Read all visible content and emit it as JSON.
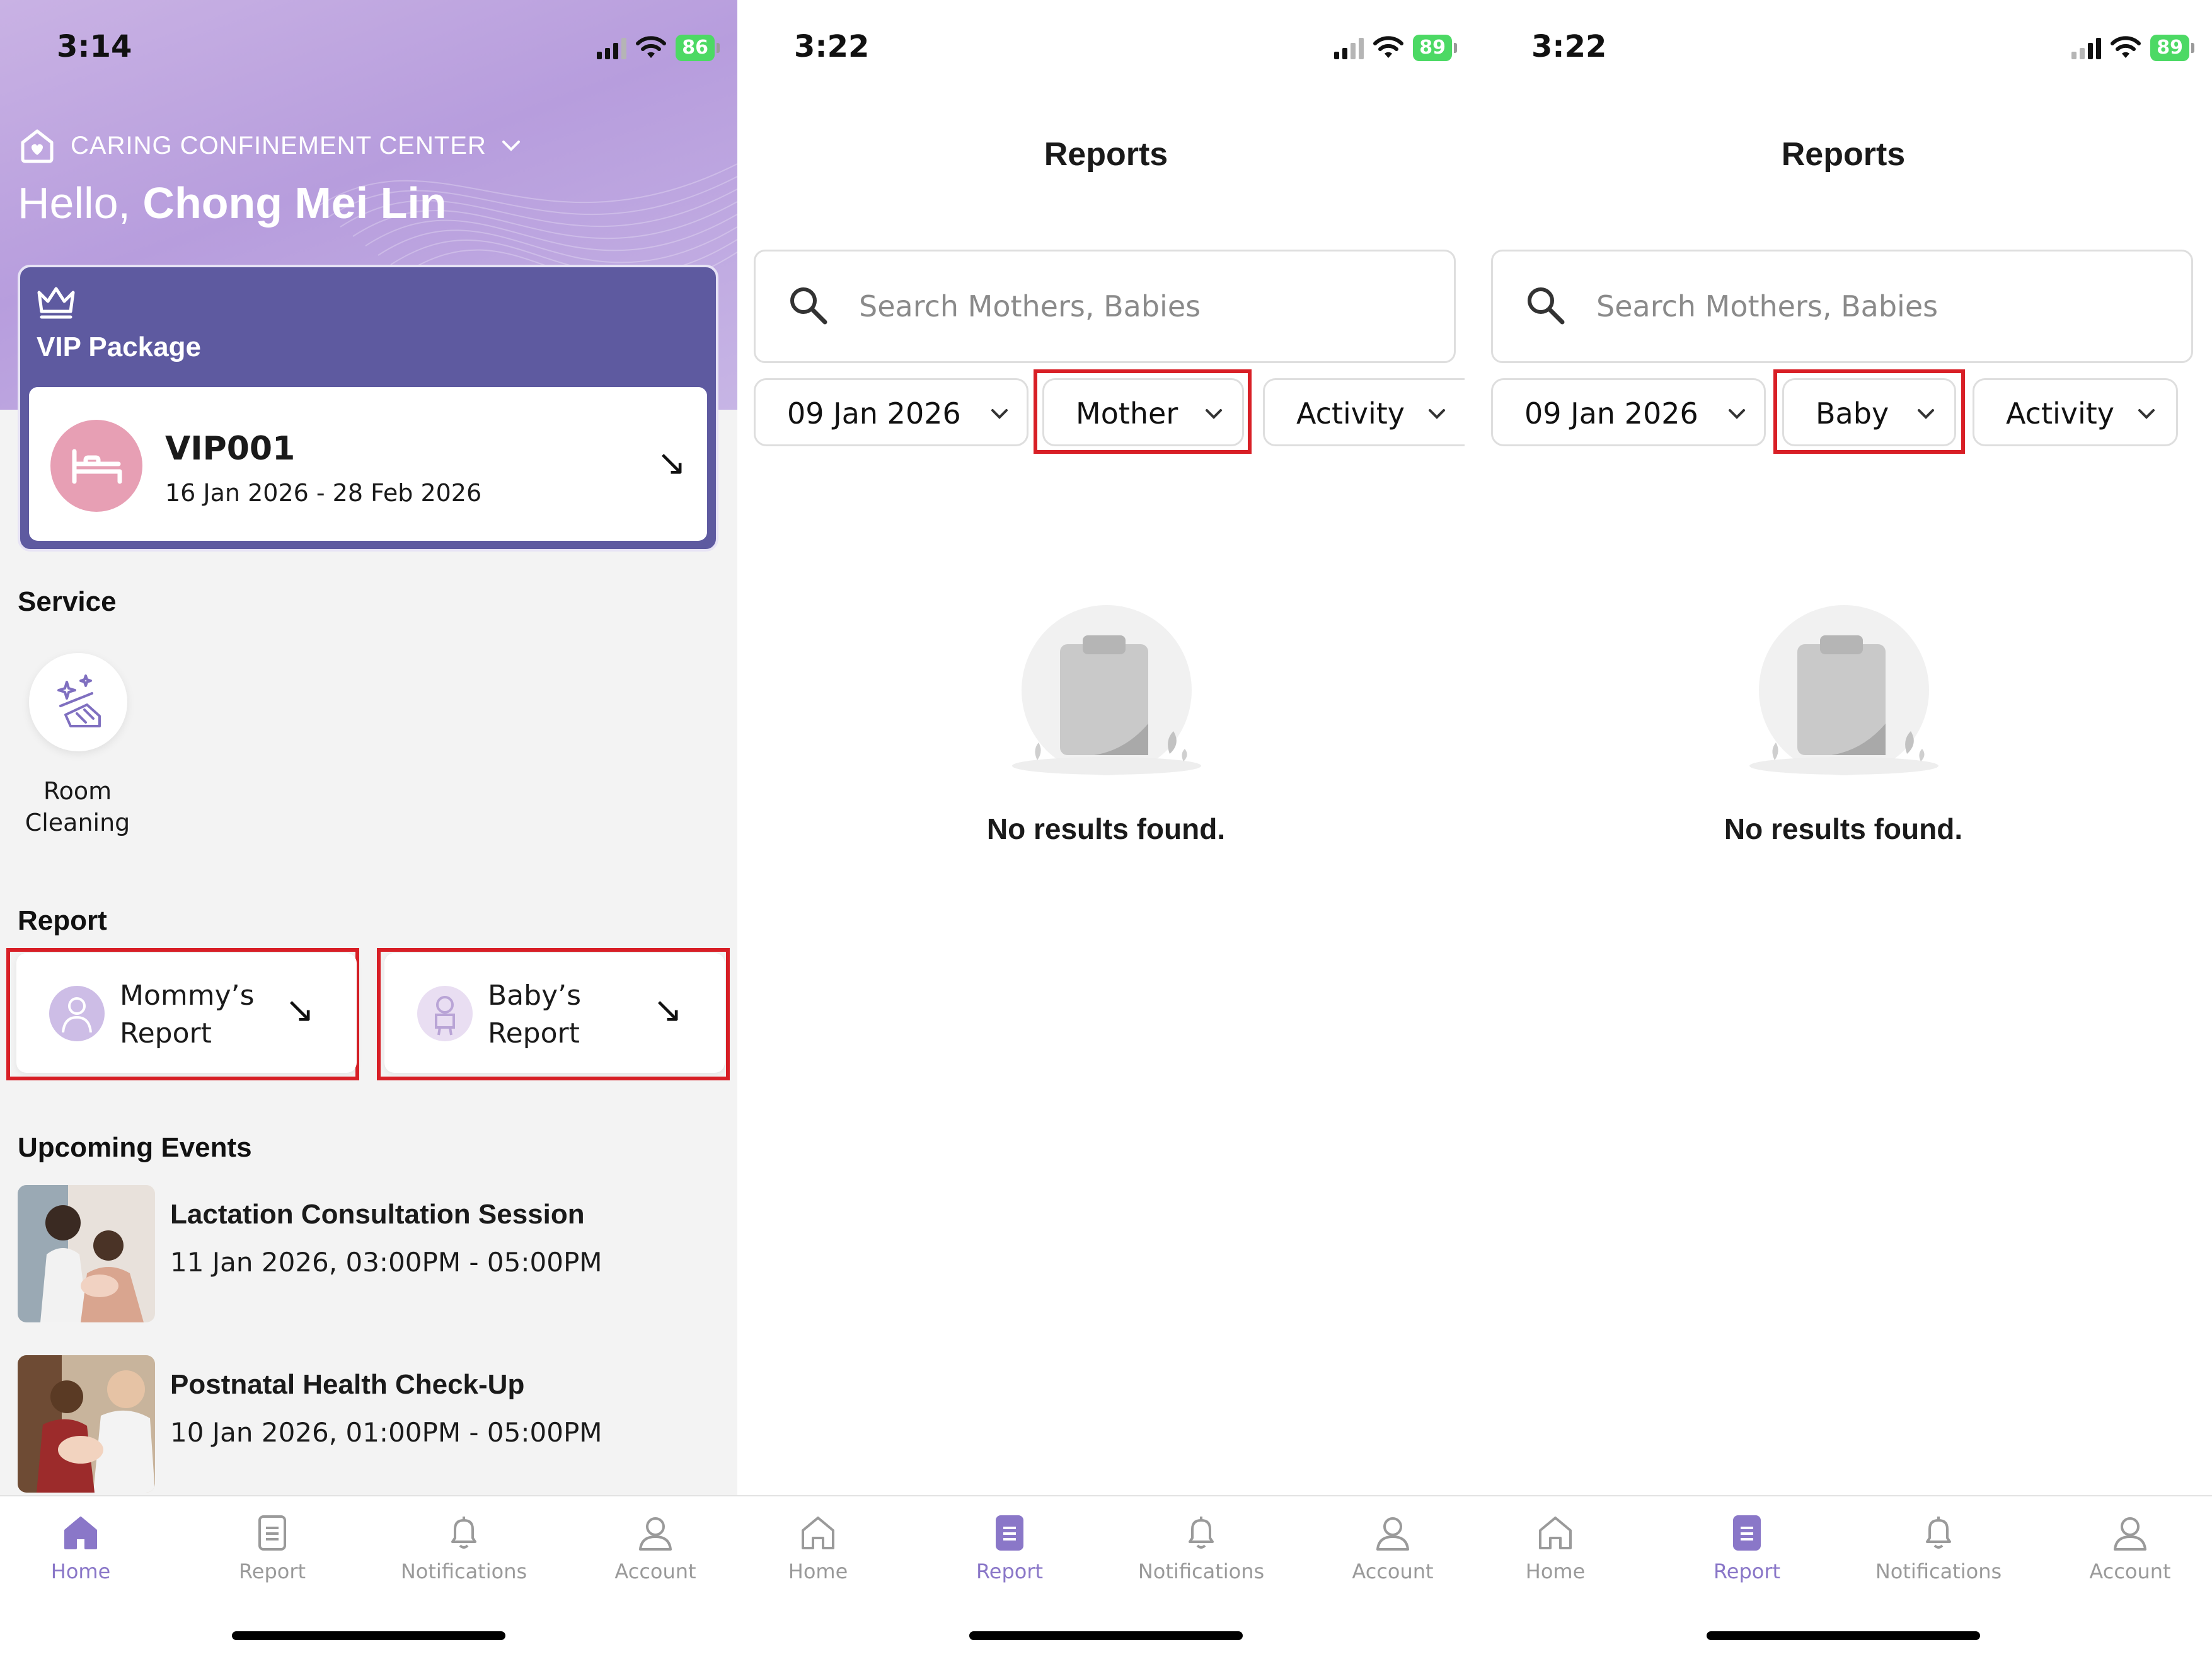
{
  "screens": {
    "home": {
      "status": {
        "time": "3:14",
        "battery": "86"
      },
      "header": {
        "center_name": "CARING CONFINEMENT CENTER",
        "greeting": "Hello,",
        "user_name": "Chong Mei Lin"
      },
      "package": {
        "title": "VIP Package",
        "code": "VIP001",
        "dates": "16 Jan 2026  - 28 Feb 2026"
      },
      "service": {
        "section_title": "Service",
        "items": [
          {
            "label": "Room Cleaning",
            "icon": "room-cleaning-icon"
          }
        ]
      },
      "report": {
        "section_title": "Report",
        "mommy_label": "Mommy’s Report",
        "baby_label": "Baby’s Report"
      },
      "events": {
        "section_title": "Upcoming Events",
        "items": [
          {
            "title": "Lactation Consultation Session",
            "time": "11 Jan 2026, 03:00PM - 05:00PM"
          },
          {
            "title": "Postnatal Health Check-Up",
            "time": "10 Jan 2026, 01:00PM - 05:00PM"
          }
        ]
      }
    },
    "reports_mother": {
      "status": {
        "time": "3:22",
        "battery": "89"
      },
      "title": "Reports",
      "search_placeholder": "Search Mothers, Babies",
      "filters": {
        "date": "09 Jan 2026",
        "type": "Mother",
        "category": "Activity"
      },
      "empty_text": "No results found."
    },
    "reports_baby": {
      "status": {
        "time": "3:22",
        "battery": "89"
      },
      "title": "Reports",
      "search_placeholder": "Search Mothers, Babies",
      "filters": {
        "date": "09 Jan 2026",
        "type": "Baby",
        "category": "Activity"
      },
      "empty_text": "No results found."
    }
  },
  "nav": {
    "home": "Home",
    "report": "Report",
    "notifications": "Notifications",
    "account": "Account"
  },
  "colors": {
    "accent": "#8a77c8",
    "vip_card": "#5e5aa0",
    "highlight": "#d81f26",
    "hero_gradient": "#b79ddd"
  }
}
